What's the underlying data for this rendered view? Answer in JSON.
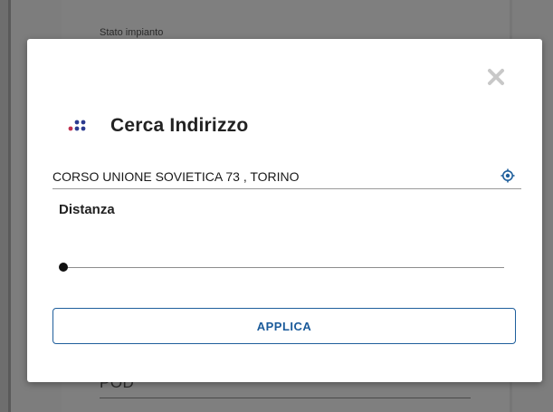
{
  "background": {
    "field_label": "Stato impianto",
    "pod_label": "POD"
  },
  "dialog": {
    "title": "Cerca Indirizzo",
    "title_icon": "dots-logo-icon",
    "close_icon": "close-icon",
    "address": {
      "value": "CORSO UNIONE SOVIETICA 73 , TORINO",
      "locate_icon": "locate-icon"
    },
    "distance": {
      "label": "Distanza",
      "slider_level": 0
    },
    "apply_label": "APPLICA"
  },
  "colors": {
    "accent": "#1f5f9c",
    "overlay": "#7d7d7d",
    "logo_red": "#c0314f",
    "logo_blue": "#2b3a8f"
  }
}
